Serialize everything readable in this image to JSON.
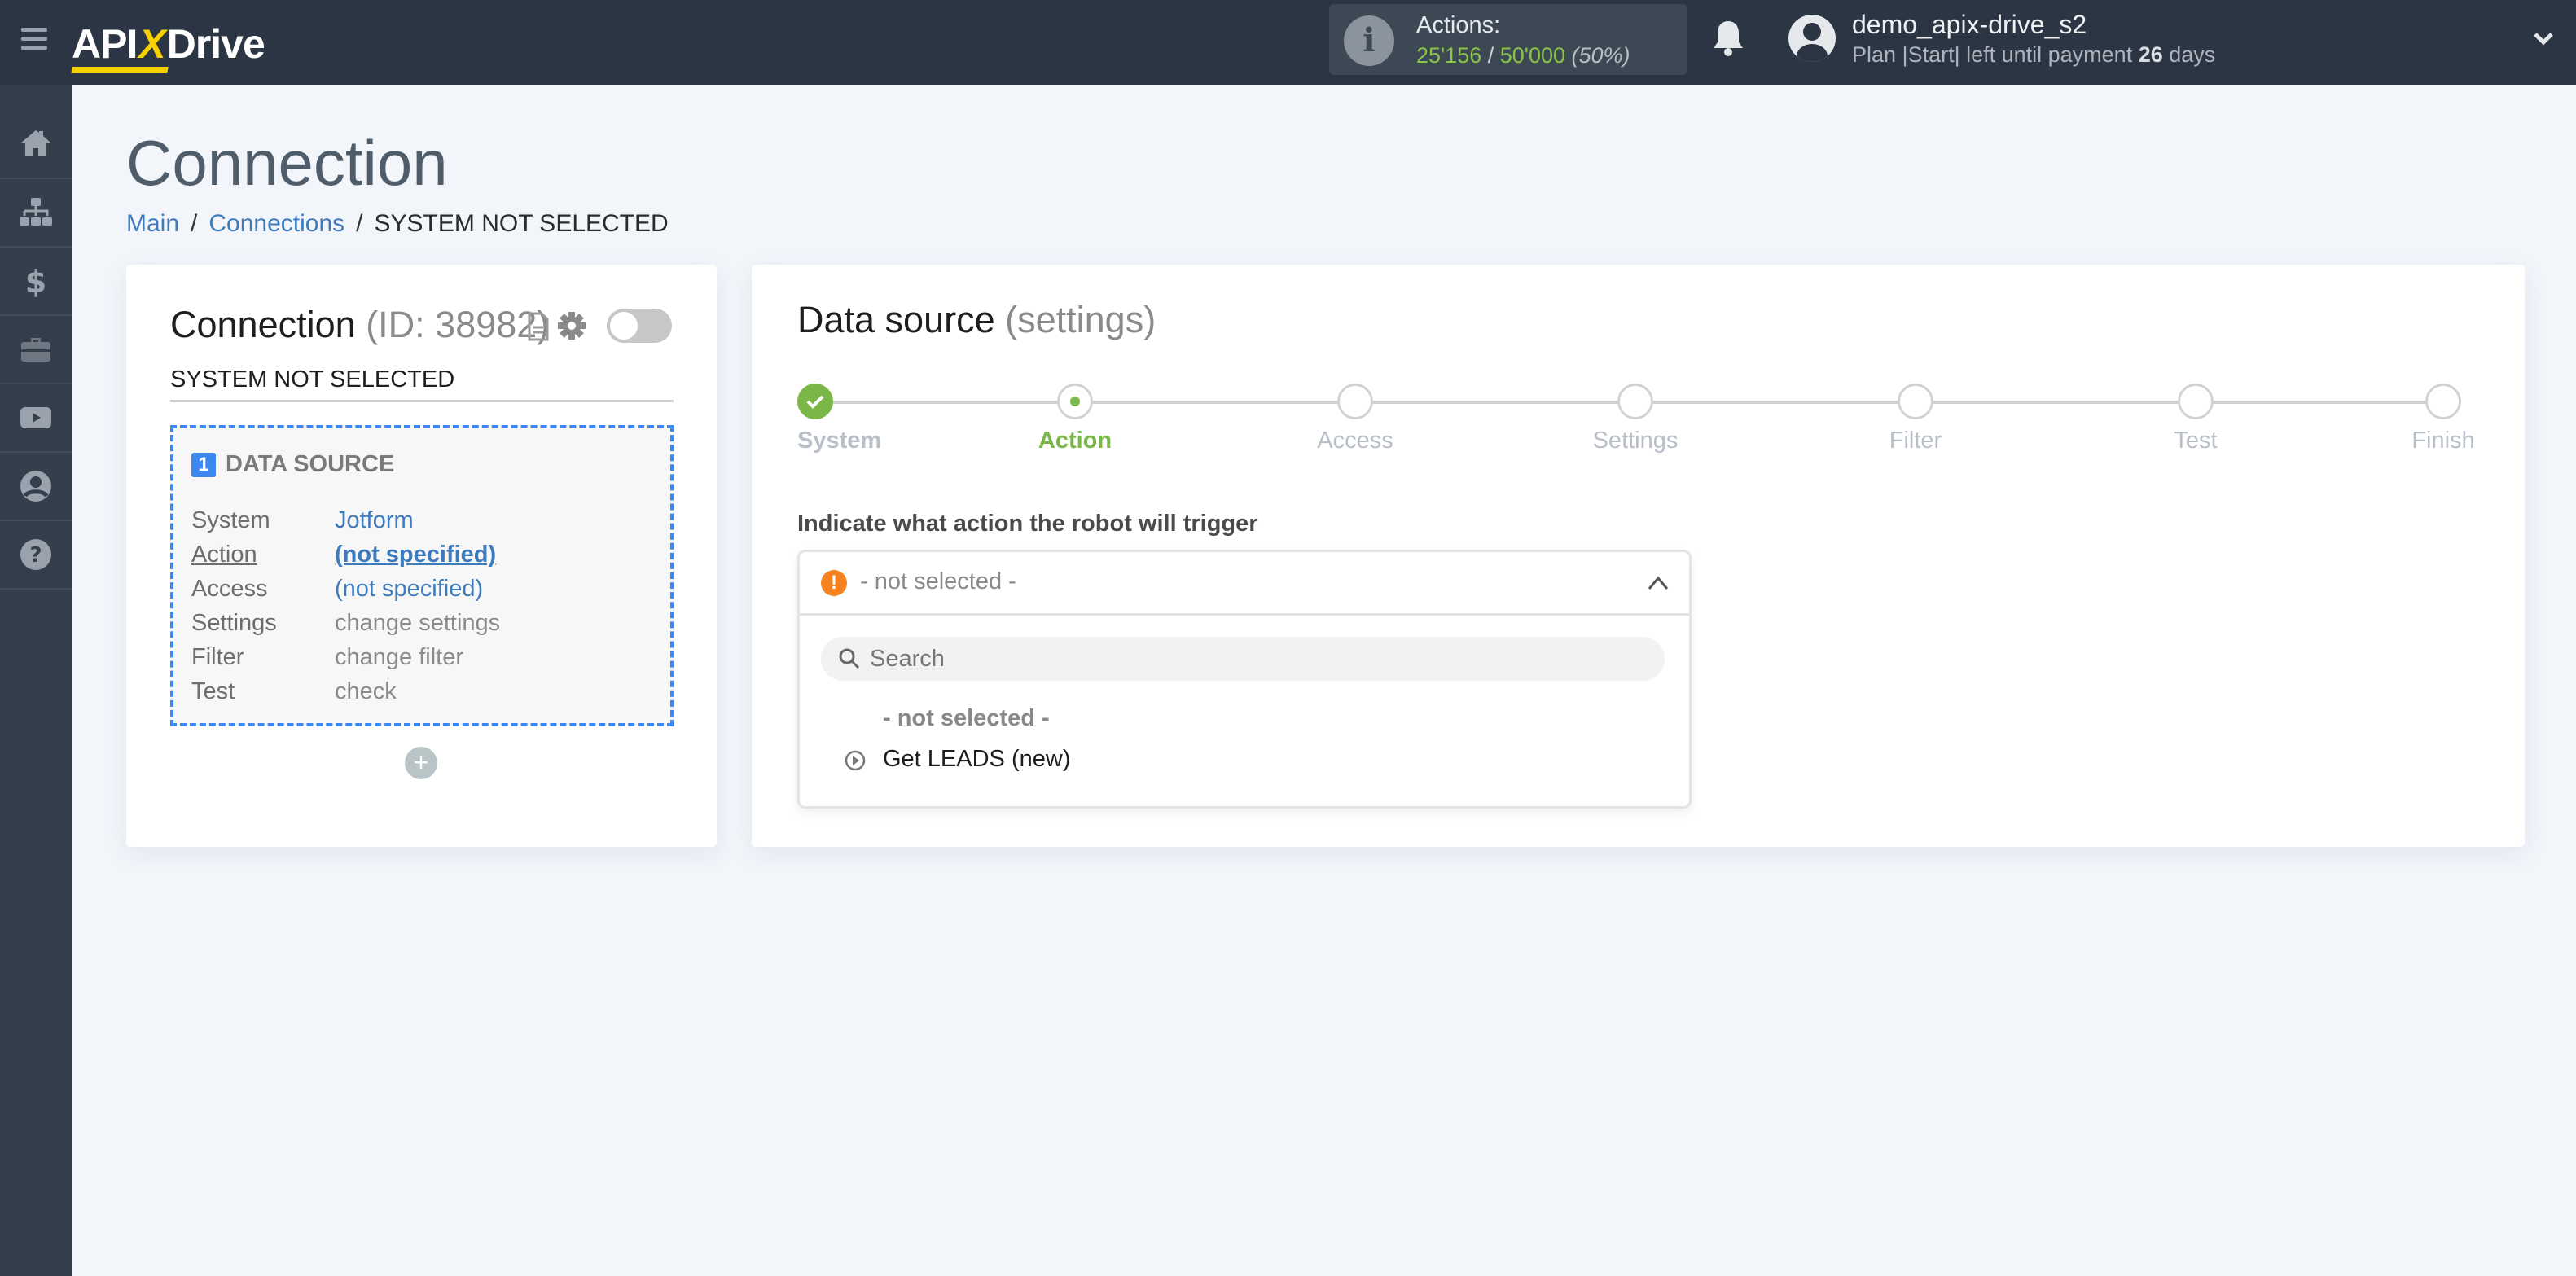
{
  "header": {
    "logo_left": "API",
    "logo_x": "X",
    "logo_right": "Drive",
    "actions_label": "Actions:",
    "actions_used": "25'156",
    "actions_sep": " / ",
    "actions_total": "50'000",
    "actions_pct": "(50%)",
    "username": "demo_apix-drive_s2",
    "plan_prefix": "Plan |Start| left until payment ",
    "plan_days": "26",
    "plan_suffix": " days"
  },
  "sidebar": {
    "items": [
      {
        "name": "home",
        "icon": "home-icon"
      },
      {
        "name": "connections",
        "icon": "sitemap-icon"
      },
      {
        "name": "billing",
        "icon": "dollar-icon"
      },
      {
        "name": "tools",
        "icon": "briefcase-icon"
      },
      {
        "name": "videos",
        "icon": "youtube-icon"
      },
      {
        "name": "account",
        "icon": "user-circle-icon"
      },
      {
        "name": "help",
        "icon": "question-circle-icon"
      }
    ]
  },
  "page": {
    "title": "Connection",
    "breadcrumb": [
      {
        "label": "Main"
      },
      {
        "label": "Connections"
      },
      {
        "label": "SYSTEM NOT SELECTED"
      }
    ],
    "breadcrumb_sep": "/"
  },
  "connection_card": {
    "title": "Connection",
    "id_text": "(ID: 38982)",
    "name": "SYSTEM NOT SELECTED",
    "enabled": false,
    "data_source": {
      "number": "1",
      "label": "DATA SOURCE",
      "rows": [
        {
          "key": "System",
          "value": "Jotform"
        },
        {
          "key": "Action",
          "value": "(not specified)"
        },
        {
          "key": "Access",
          "value": "(not specified)"
        },
        {
          "key": "Settings",
          "value": "change settings"
        },
        {
          "key": "Filter",
          "value": "change filter"
        },
        {
          "key": "Test",
          "value": "check"
        }
      ]
    },
    "add_label": "+"
  },
  "settings_card": {
    "title": "Data source",
    "subtitle": "(settings)",
    "steps": [
      {
        "label": "System",
        "state": "done"
      },
      {
        "label": "Action",
        "state": "active"
      },
      {
        "label": "Access",
        "state": "pending"
      },
      {
        "label": "Settings",
        "state": "pending"
      },
      {
        "label": "Filter",
        "state": "pending"
      },
      {
        "label": "Test",
        "state": "pending"
      },
      {
        "label": "Finish",
        "state": "pending"
      }
    ],
    "field_label": "Indicate what action the robot will trigger",
    "dropdown": {
      "selected": "- not selected -",
      "search_placeholder": "Search",
      "search_value": "",
      "options": [
        {
          "label": "- not selected -"
        },
        {
          "label": "Get LEADS (new)"
        }
      ]
    }
  },
  "colors": {
    "header_bg": "#2b3543",
    "sidebar_bg": "#353f4c",
    "accent_green": "#7ab648",
    "link_blue": "#3e7bbd",
    "dashed_blue": "#3d87f0",
    "warning_orange": "#f58220",
    "logo_yellow": "#f6d000"
  }
}
